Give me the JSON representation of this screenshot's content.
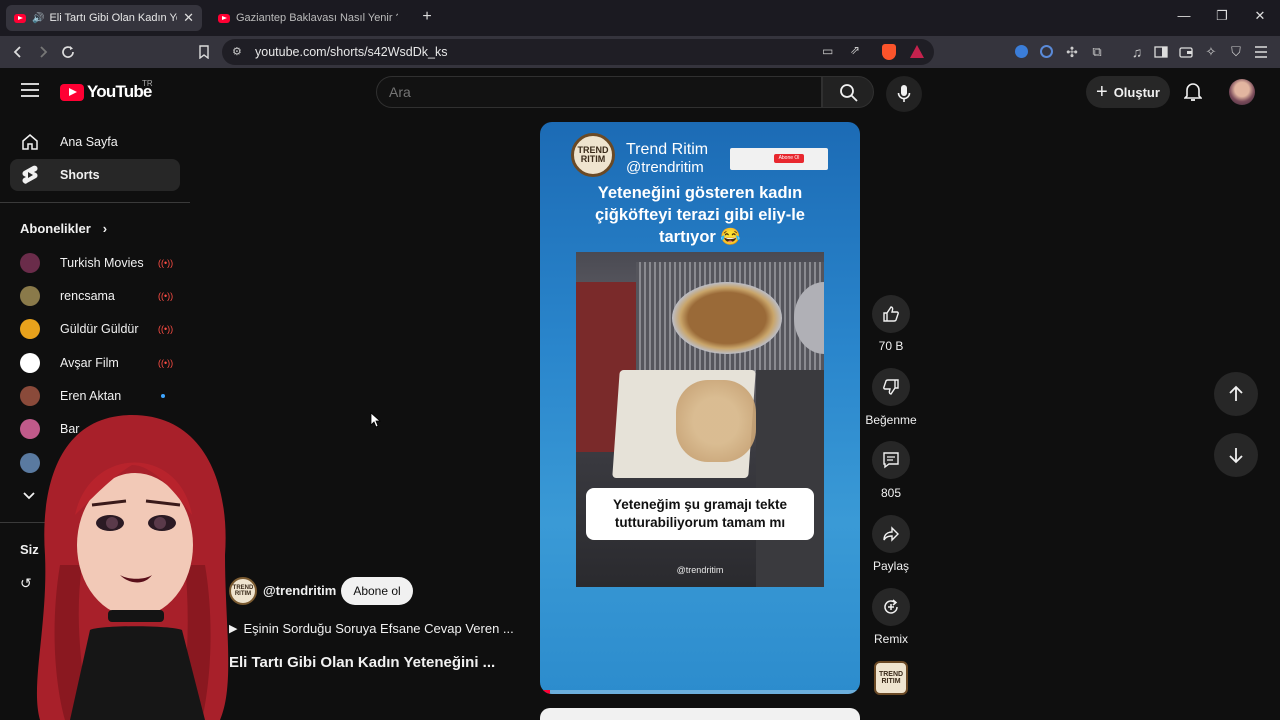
{
  "browser": {
    "tabs": [
      {
        "title": "Eli Tartı Gibi Olan Kadın Yeteneğini",
        "active": true
      },
      {
        "title": "Gaziantep Baklavası Nasıl Yenir ? - Ke",
        "active": false
      }
    ],
    "new_tab": "+",
    "url": "youtube.com/shorts/s42WsdDk_ks"
  },
  "youtube": {
    "logo_text": "YouTube",
    "country": "TR",
    "search_placeholder": "Ara",
    "create_label": "Oluştur"
  },
  "sidebar": {
    "home": "Ana Sayfa",
    "shorts": "Shorts",
    "subscriptions_title": "Abonelikler",
    "subscriptions": [
      {
        "name": "Turkish Movies",
        "status": "live",
        "color": "#6a2c4a"
      },
      {
        "name": "rencsama",
        "status": "live",
        "color": "#8a7a4a"
      },
      {
        "name": "Güldür Güldür",
        "status": "live",
        "color": "#e8a21c"
      },
      {
        "name": "Avşar Film",
        "status": "live",
        "color": "#ffffff"
      },
      {
        "name": "Eren Aktan",
        "status": "new",
        "color": "#8a4a3a"
      },
      {
        "name": "Bar",
        "status": "",
        "color": "#c05a8a"
      },
      {
        "name": "",
        "status": "",
        "color": "#5a7aa0"
      }
    ],
    "you_title": "Siz"
  },
  "short": {
    "channel_name": "Trend Ritim",
    "channel_handle": "@trendritim",
    "logo_text_1": "TREND",
    "logo_text_2": "RITIM",
    "subscribe_badge": "Abone Ol",
    "headline": "Yeteneğini gösteren kadın çiğköfteyi terazi gibi eliy-le tartıyor 😂",
    "caption": "Yeteneğim şu gramajı tekte tutturabiliyorum tamam mı",
    "watermark": "@trendritim",
    "channel_label": "@trendritim",
    "subscribe_button": "Abone ol",
    "playlist_line": "Eşinin Sorduğu Soruya Efsane Cevap Veren ...",
    "title": "Eli Tartı Gibi Olan Kadın Yeteneğini ..."
  },
  "actions": {
    "like_count": "70 B",
    "dislike_label": "Beğenme",
    "comment_count": "805",
    "share_label": "Paylaş",
    "remix_label": "Remix"
  },
  "colors": {
    "accent": "#ff0033",
    "background": "#0f0f0f"
  }
}
